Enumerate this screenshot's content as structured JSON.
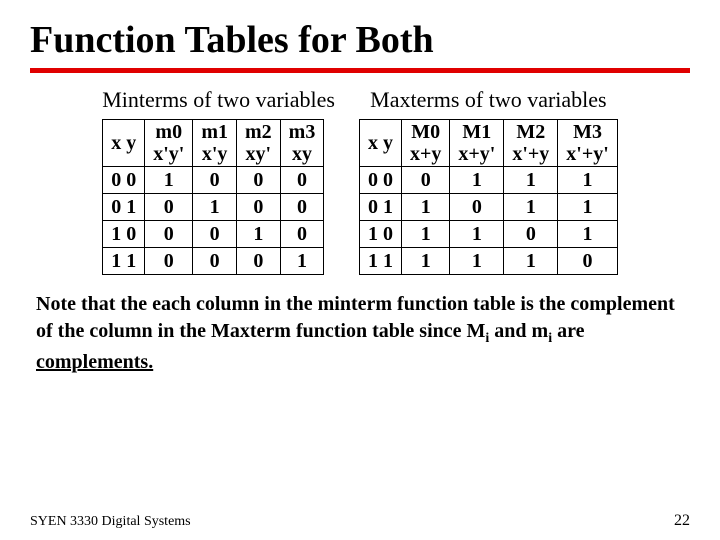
{
  "title": "Function Tables for Both",
  "minterms": {
    "subtitle": "Minterms of two variables",
    "col_xy": "x y",
    "headers": [
      {
        "top": "m0",
        "bot": "x'y'"
      },
      {
        "top": "m1",
        "bot": "x'y"
      },
      {
        "top": "m2",
        "bot": "xy'"
      },
      {
        "top": "m3",
        "bot": "xy"
      }
    ],
    "rows": [
      {
        "xy": "0 0",
        "v": [
          "1",
          "0",
          "0",
          "0"
        ]
      },
      {
        "xy": "0 1",
        "v": [
          "0",
          "1",
          "0",
          "0"
        ]
      },
      {
        "xy": "1 0",
        "v": [
          "0",
          "0",
          "1",
          "0"
        ]
      },
      {
        "xy": "1 1",
        "v": [
          "0",
          "0",
          "0",
          "1"
        ]
      }
    ]
  },
  "maxterms": {
    "subtitle": "Maxterms of two variables",
    "col_xy": "x y",
    "headers": [
      {
        "top": "M0",
        "bot": "x+y"
      },
      {
        "top": "M1",
        "bot": "x+y'"
      },
      {
        "top": "M2",
        "bot": "x'+y"
      },
      {
        "top": "M3",
        "bot": "x'+y'"
      }
    ],
    "rows": [
      {
        "xy": "0 0",
        "v": [
          "0",
          "1",
          "1",
          "1"
        ]
      },
      {
        "xy": "0 1",
        "v": [
          "1",
          "0",
          "1",
          "1"
        ]
      },
      {
        "xy": "1 0",
        "v": [
          "1",
          "1",
          "0",
          "1"
        ]
      },
      {
        "xy": "1 1",
        "v": [
          "1",
          "1",
          "1",
          "0"
        ]
      }
    ]
  },
  "note": {
    "t1": "Note that the each column in the minterm function table is the complement of the column in the Maxterm function table since M",
    "sub1": "i",
    "t2": " and m",
    "sub2": "i",
    "t3": " are ",
    "u": "complements.",
    "t4": ""
  },
  "footer": {
    "course": "SYEN 3330 Digital Systems",
    "page": "22"
  }
}
